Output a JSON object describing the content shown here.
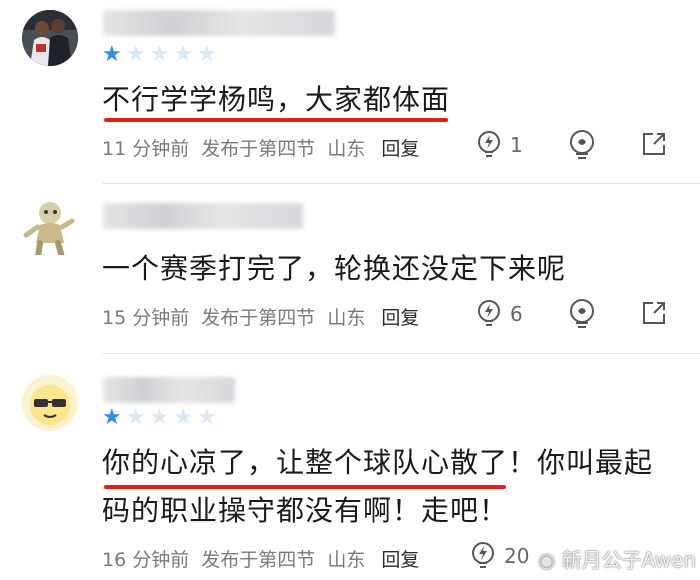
{
  "comments": [
    {
      "text": "不行学学杨鸣，大家都体面",
      "time": "11 分钟前",
      "posted_in": "发布于第四节",
      "location": "山东",
      "reply_label": "回复",
      "like_count": "1",
      "rating": 1,
      "rating_max": 5
    },
    {
      "text": "一个赛季打完了，轮换还没定下来呢",
      "time": "15 分钟前",
      "posted_in": "发布于第四节",
      "location": "山东",
      "reply_label": "回复",
      "like_count": "6"
    },
    {
      "text_line1": "你的心凉了，让整个球队心散了！你叫最起",
      "text_line2": "码的职业操守都没有啊！走吧！",
      "time": "16 分钟前",
      "posted_in": "发布于第四节",
      "location": "山东",
      "reply_label": "回复",
      "like_count": "20",
      "rating": 1,
      "rating_max": 5
    }
  ],
  "watermark": "新月公子Awen",
  "colors": {
    "star_active": "#2f8fe6",
    "star_inactive": "#d8e8f6",
    "highlight_underline": "#e0201a"
  },
  "icons": {
    "like": "lightbulb-like-icon",
    "share": "share-external-icon",
    "weibo": "weibo-logo-icon"
  }
}
